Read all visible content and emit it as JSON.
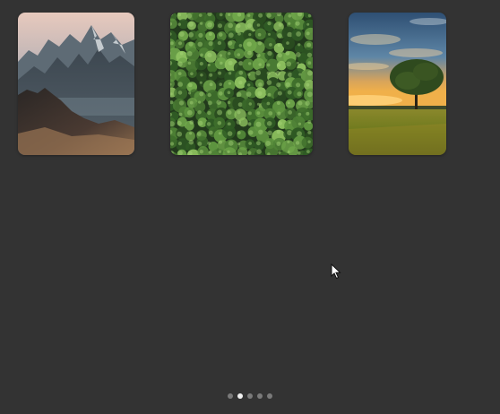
{
  "gallery": {
    "cards": [
      {
        "subject": "mountain-landscape"
      },
      {
        "subject": "aerial-forest"
      },
      {
        "subject": "lone-tree-sunset-field"
      }
    ]
  },
  "pager": {
    "total": 5,
    "active_index": 1
  },
  "colors": {
    "background": "#333333",
    "dot_inactive": "#7a7a7a",
    "dot_active": "#f2f2f2"
  }
}
